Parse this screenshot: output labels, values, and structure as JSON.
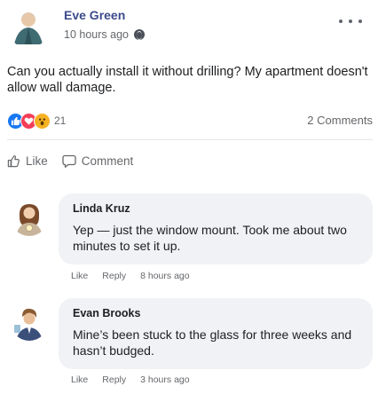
{
  "post": {
    "author": "Eve Green",
    "time": "10 hours ago",
    "text": "Can you actually install it without drilling? My apartment doesn't allow wall damage.",
    "reaction_count": "21",
    "comments_count": "2 Comments"
  },
  "actions": {
    "like": "Like",
    "comment": "Comment"
  },
  "comments": [
    {
      "author": "Linda Kruz",
      "text": "Yep — just the window mount. Took me about two minutes to set it up.",
      "like": "Like",
      "reply": "Reply",
      "time": "8 hours ago"
    },
    {
      "author": "Evan Brooks",
      "text": "Mine’s been stuck to the glass for three weeks and hasn’t budged.",
      "like": "Like",
      "reply": "Reply",
      "time": "3 hours ago"
    }
  ],
  "colors": {
    "author_name": "#3b4a8c",
    "like_reaction": "#1877f2",
    "love_reaction": "#f33e58",
    "wow_reaction": "#f7b125",
    "bubble_bg": "#f0f2f5"
  },
  "icons": [
    "globe-icon",
    "more-icon",
    "like-icon",
    "comment-icon",
    "like-reaction-icon",
    "love-reaction-icon",
    "wow-reaction-icon"
  ]
}
